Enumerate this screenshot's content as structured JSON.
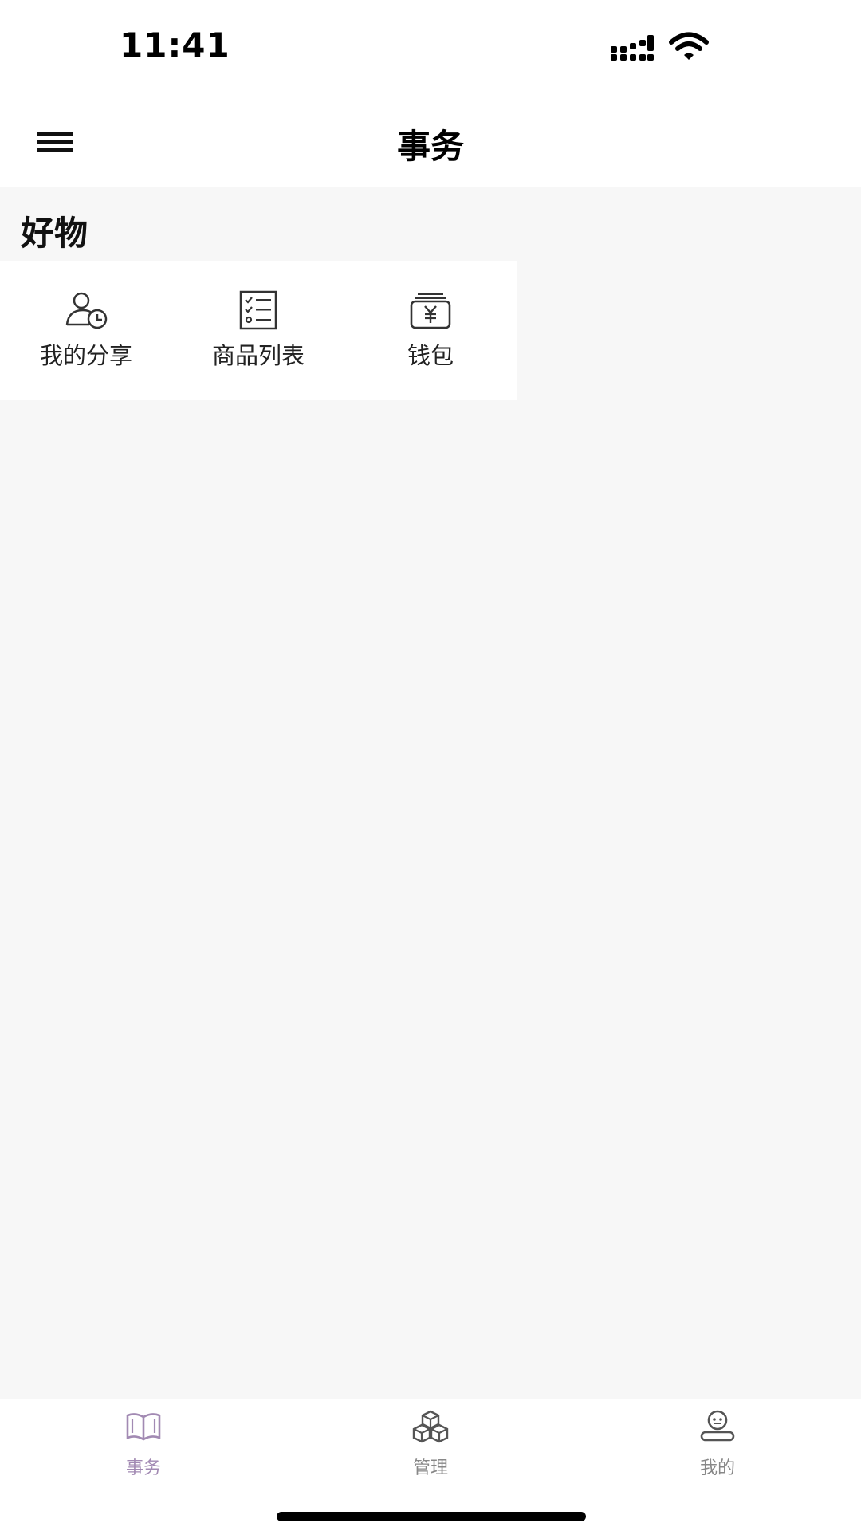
{
  "status_bar": {
    "time": "11:41"
  },
  "header": {
    "title": "事务",
    "menu_icon": "hamburger-menu-icon"
  },
  "section": {
    "title": "好物",
    "items": [
      {
        "label": "我的分享",
        "icon": "user-clock-icon"
      },
      {
        "label": "商品列表",
        "icon": "checklist-icon"
      },
      {
        "label": "钱包",
        "icon": "wallet-yen-icon"
      }
    ]
  },
  "tab_bar": {
    "active_color": "#a28ab3",
    "inactive_color": "#888888",
    "tabs": [
      {
        "label": "事务",
        "icon": "open-book-icon",
        "active": true
      },
      {
        "label": "管理",
        "icon": "boxes-icon",
        "active": false
      },
      {
        "label": "我的",
        "icon": "profile-icon",
        "active": false
      }
    ]
  },
  "colors": {
    "background": "#f7f7f7",
    "surface": "#ffffff",
    "text": "#111111"
  }
}
